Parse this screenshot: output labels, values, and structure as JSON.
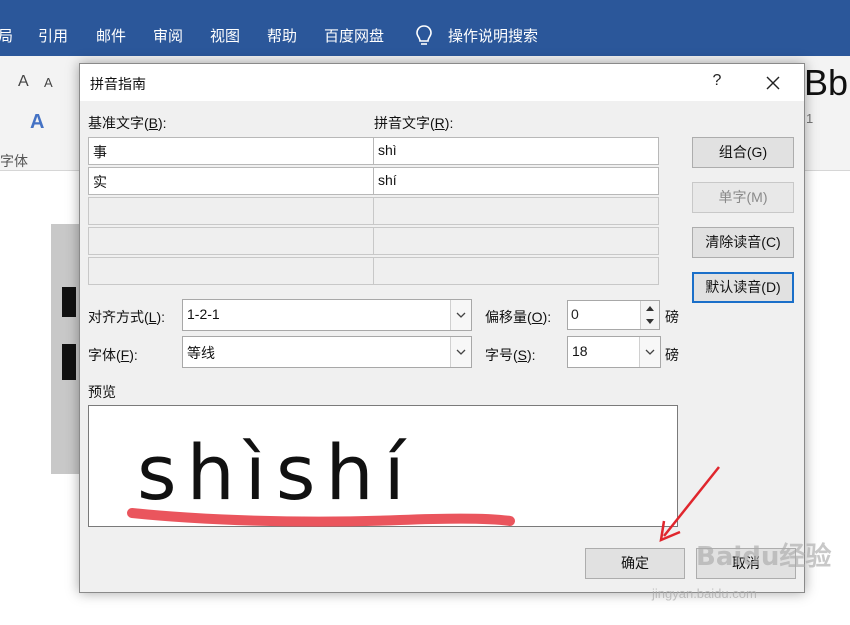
{
  "ribbon": {
    "tabs": [
      "局",
      "引用",
      "邮件",
      "审阅",
      "视图",
      "帮助",
      "百度网盘"
    ],
    "tell_me": "操作说明搜索",
    "font_group_label": "字体",
    "font_size_up": "A",
    "font_size_down": "A",
    "style_fragment": "Bb",
    "page_number_fragment": "1"
  },
  "dialog": {
    "title": "拼音指南",
    "help": "?",
    "base_text_label": "基准文字(",
    "base_text_hotkey": "B",
    "base_text_label_end": "):",
    "ruby_text_label": "拼音文字(",
    "ruby_text_hotkey": "R",
    "ruby_text_label_end": "):",
    "rows": [
      {
        "base": "事",
        "ruby": "shì"
      },
      {
        "base": "实",
        "ruby": "shí"
      },
      {
        "base": "",
        "ruby": ""
      },
      {
        "base": "",
        "ruby": ""
      },
      {
        "base": "",
        "ruby": ""
      }
    ],
    "buttons": {
      "group": "组合(G)",
      "mono": "单字(M)",
      "clear": "清除读音(C)",
      "default": "默认读音(D)",
      "ok": "确定",
      "cancel": "取消"
    },
    "alignment_label": "对齐方式(",
    "alignment_hotkey": "L",
    "alignment_label_end": "):",
    "alignment_value": "1-2-1",
    "offset_label": "偏移量(",
    "offset_hotkey": "O",
    "offset_label_end": "):",
    "offset_value": "0",
    "offset_unit": "磅",
    "font_label": "字体(",
    "font_hotkey": "F",
    "font_label_end": "):",
    "font_value": "等线",
    "size_label": "字号(",
    "size_hotkey": "S",
    "size_label_end": "):",
    "size_value": "18",
    "size_unit": "磅",
    "preview_label": "预览",
    "preview_text": "shìshí"
  },
  "annotation": {
    "underline_color": "#e8474f",
    "arrow_color": "#e0262d"
  },
  "watermark": {
    "brand": "Baidu经验",
    "url": "jingyan.baidu.com"
  }
}
